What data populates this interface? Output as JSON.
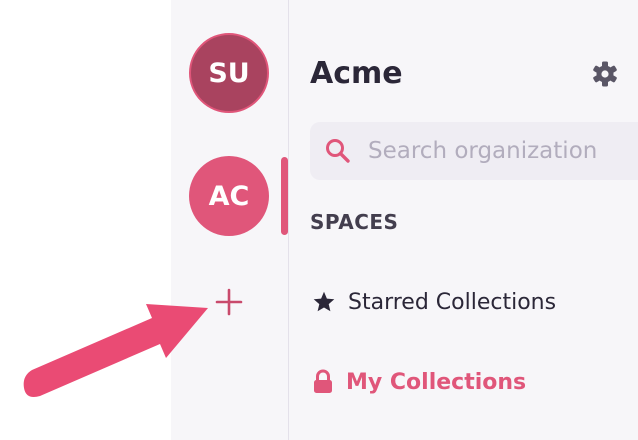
{
  "org_rail": {
    "organizations": [
      {
        "initials": "SU",
        "color": "#a9435f"
      },
      {
        "initials": "AC",
        "color": "#e0567a",
        "active": true
      }
    ],
    "add_icon": "plus-icon"
  },
  "main": {
    "org_name": "Acme",
    "settings_icon": "gear-icon",
    "search": {
      "icon": "search-icon",
      "placeholder": "Search organization"
    },
    "sections": [
      {
        "heading": "SPACES",
        "items": [
          {
            "icon": "star-icon",
            "label": "Starred Collections"
          },
          {
            "icon": "lock-icon",
            "label": "My Collections",
            "active": true
          }
        ]
      }
    ]
  },
  "annotation": {
    "icon": "arrow-icon",
    "color": "#ea4b74"
  },
  "colors": {
    "accent": "#e0567a",
    "text": "#2b2738",
    "panel": "#f7f6f9"
  }
}
